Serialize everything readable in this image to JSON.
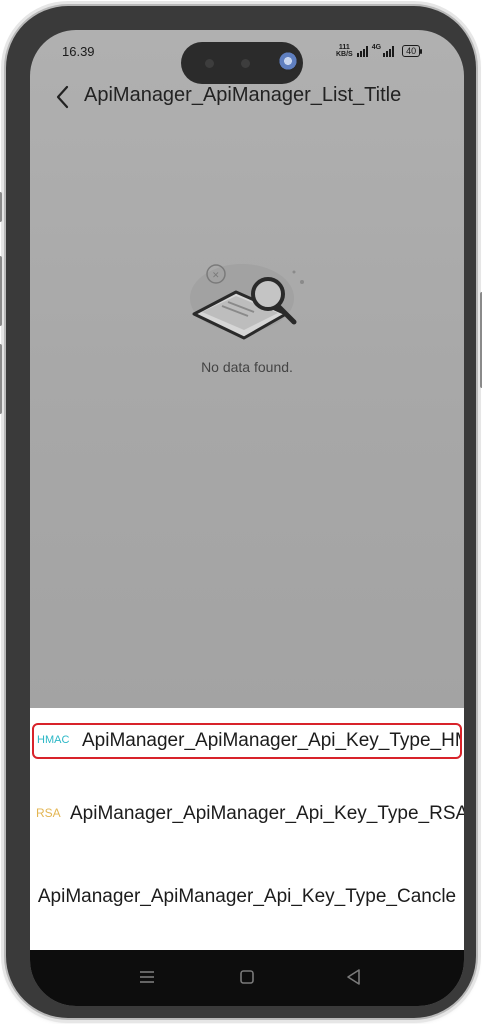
{
  "status_bar": {
    "time": "16.39",
    "speed_value": "111",
    "speed_unit": "KB/S",
    "network": "4G",
    "battery": "40"
  },
  "header": {
    "back_icon": "chevron-left-icon",
    "title": "ApiManager_ApiManager_List_Title"
  },
  "empty_state": {
    "icon": "no-data-magnifier-icon",
    "message": "No data found."
  },
  "action_sheet": {
    "options": [
      {
        "tag": "HMAC",
        "label": "ApiManager_ApiManager_Api_Key_Type_HMAC",
        "tag_color": "#2bb7c6",
        "highlighted": true,
        "highlight_color": "#d8232a"
      },
      {
        "tag": "RSA",
        "label": "ApiManager_ApiManager_Api_Key_Type_RSA",
        "tag_color": "#e3b552",
        "highlighted": false
      }
    ],
    "cancel_label": "ApiManager_ApiManager_Api_Key_Type_Cancle"
  },
  "navigation_bar": {
    "menu_icon": "menu-icon",
    "home_icon": "home-square-icon",
    "back_icon": "back-triangle-icon"
  }
}
